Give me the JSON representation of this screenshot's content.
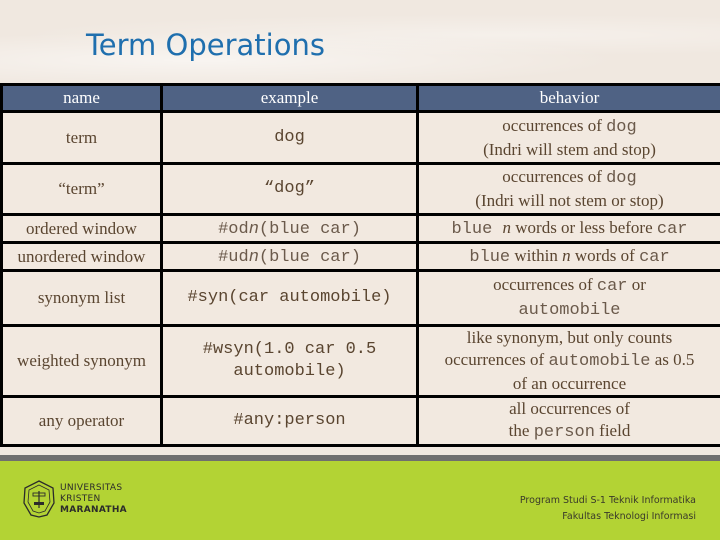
{
  "slide": {
    "title": "Term Operations"
  },
  "table": {
    "headers": [
      "name",
      "example",
      "behavior"
    ],
    "rows": [
      {
        "name": "term",
        "example": "dog",
        "behavior": [
          {
            "t": "occurrences of ",
            "s": "text"
          },
          {
            "t": "dog",
            "s": "mono"
          },
          {
            "t": "(Indri will stem and stop)",
            "s": "text",
            "br": true
          }
        ]
      },
      {
        "name": "“term”",
        "example": "“dog”",
        "behavior": [
          {
            "t": "occurrences of ",
            "s": "text"
          },
          {
            "t": "dog",
            "s": "mono"
          },
          {
            "t": "(Indri will not stem or stop)",
            "s": "text",
            "br": true
          }
        ]
      },
      {
        "name": "ordered window",
        "example_parts": [
          {
            "t": "#od",
            "s": "mono"
          },
          {
            "t": "n",
            "s": "mono-it"
          },
          {
            "t": "(blue car)",
            "s": "mono"
          }
        ],
        "behavior": [
          {
            "t": "blue ",
            "s": "mono"
          },
          {
            "t": "n",
            "s": "it"
          },
          {
            "t": " words or less before ",
            "s": "text"
          },
          {
            "t": "car",
            "s": "mono"
          }
        ]
      },
      {
        "name": "unordered window",
        "example_parts": [
          {
            "t": "#ud",
            "s": "mono"
          },
          {
            "t": "n",
            "s": "mono-it"
          },
          {
            "t": "(blue car)",
            "s": "mono"
          }
        ],
        "behavior": [
          {
            "t": "blue",
            "s": "mono"
          },
          {
            "t": " within ",
            "s": "text"
          },
          {
            "t": "n",
            "s": "it"
          },
          {
            "t": " words of ",
            "s": "text"
          },
          {
            "t": "car",
            "s": "mono"
          }
        ]
      },
      {
        "name": "synonym list",
        "example": "#syn(car automobile)",
        "behavior": [
          {
            "t": "occurrences of ",
            "s": "text"
          },
          {
            "t": "car",
            "s": "mono"
          },
          {
            "t": " or",
            "s": "text"
          },
          {
            "t": "automobile",
            "s": "mono",
            "br": true
          }
        ]
      },
      {
        "name": "weighted synonym",
        "example": "#wsyn(1.0 car 0.5 automobile)",
        "behavior": [
          {
            "t": "like synonym, but only counts",
            "s": "text"
          },
          {
            "t": "occurrences of ",
            "s": "text",
            "br": true
          },
          {
            "t": "automobile",
            "s": "mono"
          },
          {
            "t": " as 0.5",
            "s": "text"
          },
          {
            "t": "of an occurrence",
            "s": "text",
            "br": true
          }
        ]
      },
      {
        "name": "any operator",
        "example": "#any:person",
        "behavior": [
          {
            "t": "all occurrences of",
            "s": "text"
          },
          {
            "t": "the ",
            "s": "text",
            "br": true
          },
          {
            "t": "person",
            "s": "mono"
          },
          {
            "t": " field",
            "s": "text"
          }
        ]
      }
    ]
  },
  "footer": {
    "university_lines": [
      "UNIVERSITAS",
      "KRISTEN",
      "MARANATHA"
    ],
    "program_lines": [
      "Program Studi S-1 Teknik Informatika",
      "Fakultas Teknologi Informasi"
    ],
    "colors": {
      "footer_bg": "#b3d334",
      "header_bg": "#4f6284",
      "title": "#1f6fae"
    }
  }
}
